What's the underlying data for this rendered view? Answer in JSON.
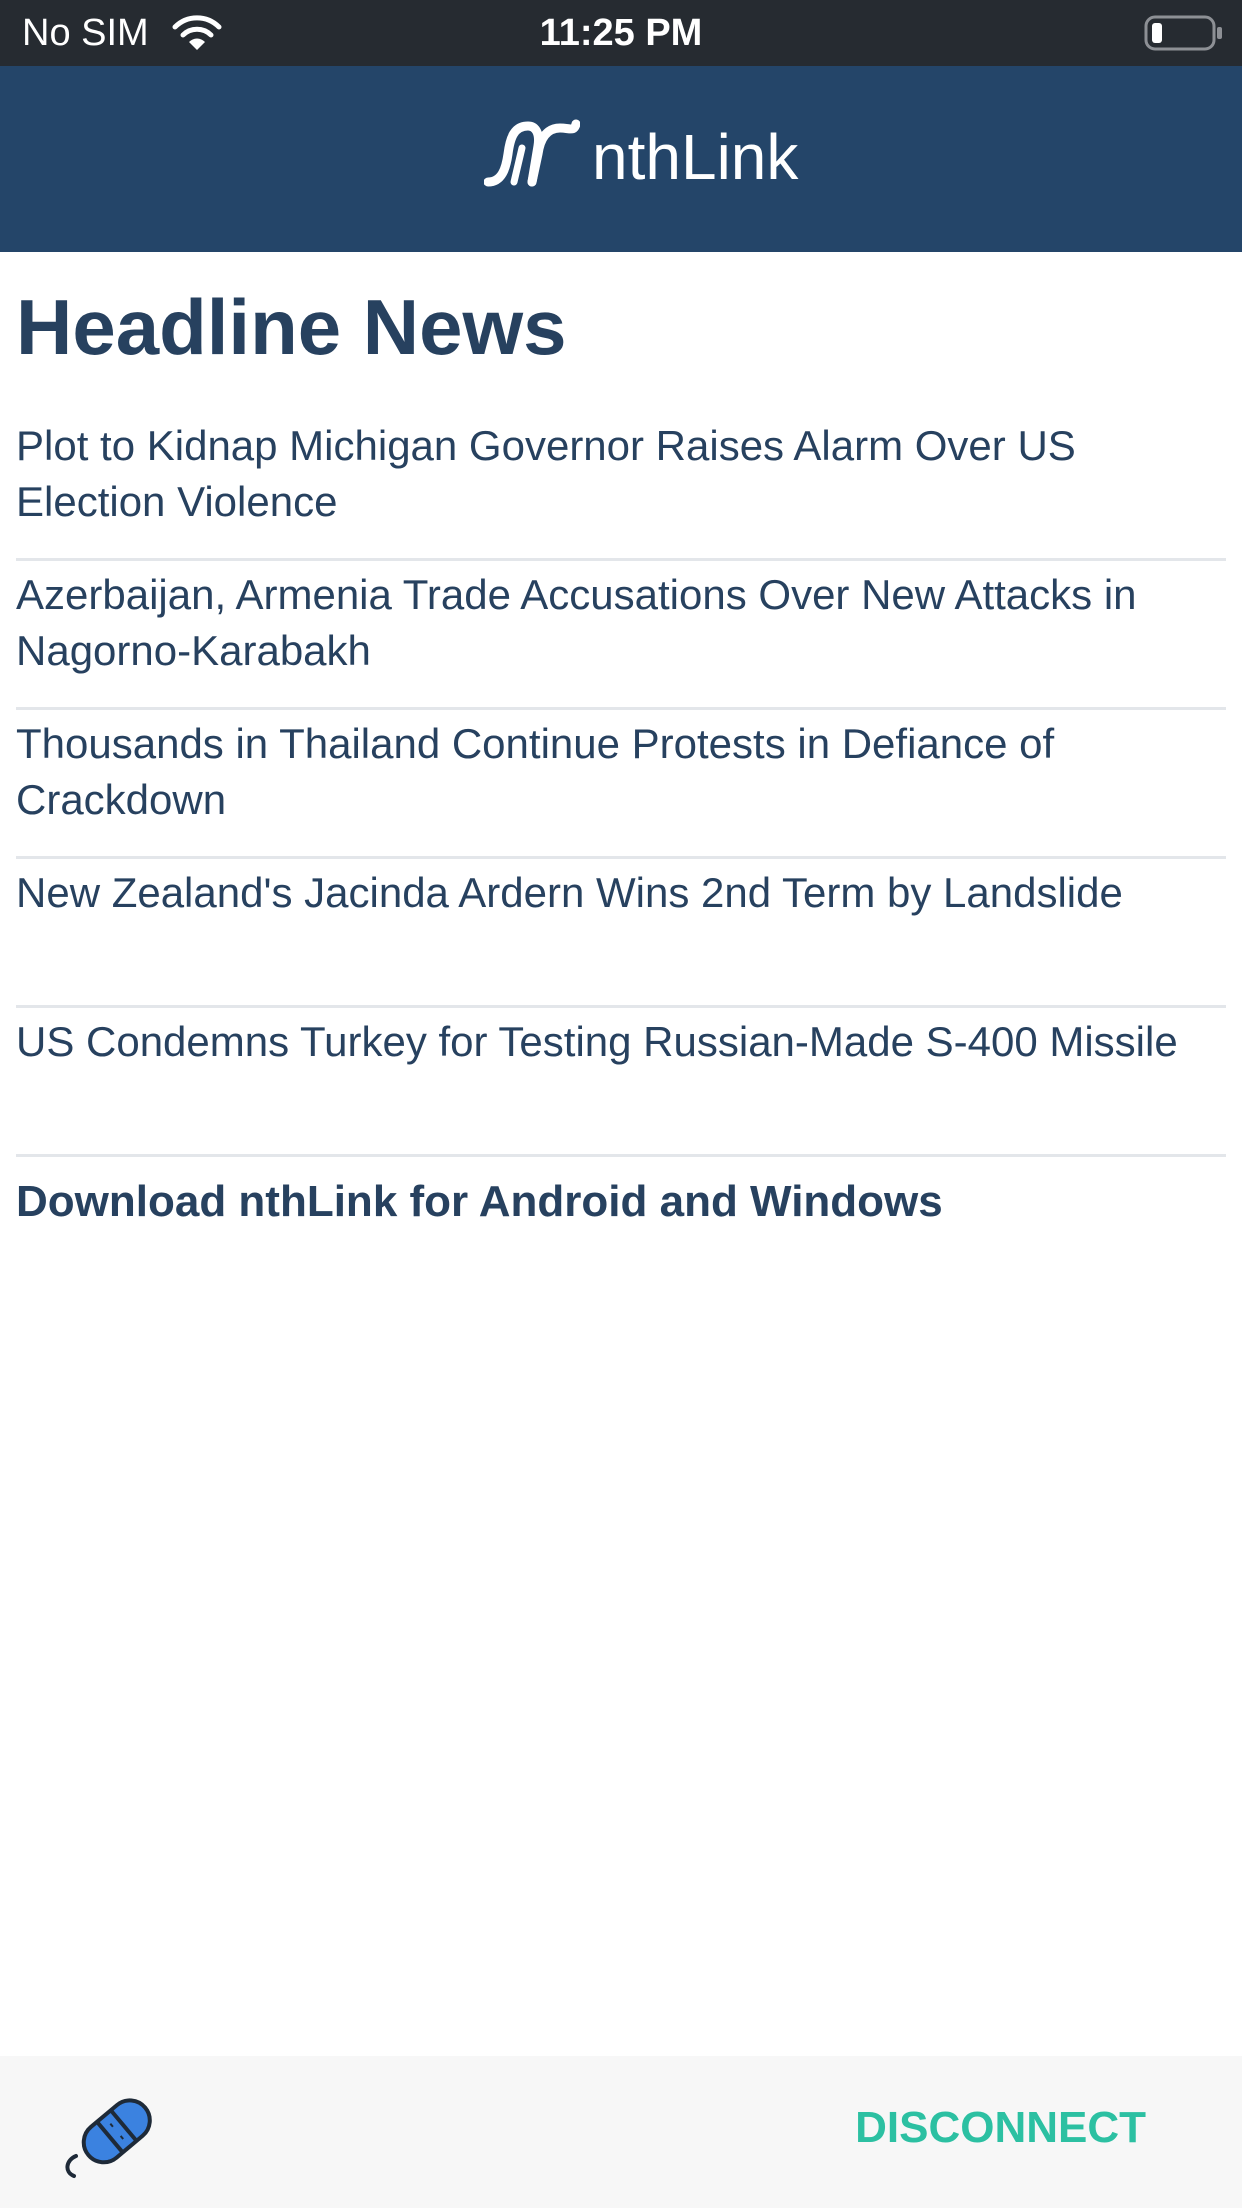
{
  "status_bar": {
    "carrier": "No SIM",
    "time": "11:25 PM",
    "icons": [
      "wifi-icon",
      "battery-icon"
    ]
  },
  "header": {
    "logo_text": "nthLink",
    "logo_icon": "nthlink-logo-icon"
  },
  "main": {
    "title": "Headline News",
    "headlines": [
      "Plot to Kidnap Michigan Governor Raises Alarm Over US Election Violence",
      "Azerbaijan, Armenia Trade Accusations Over New Attacks in Nagorno-Karabakh",
      "Thousands in Thailand Continue Protests in Defiance of Crackdown",
      "New Zealand's Jacinda Ardern Wins 2nd Term by Landslide",
      "US Condemns Turkey for Testing Russian-Made S-400 Missile"
    ],
    "download_link": "Download nthLink for Android and Windows"
  },
  "bottom_bar": {
    "connection_icon": "plug-icon",
    "disconnect_label": "DISCONNECT"
  },
  "colors": {
    "header_bg": "#244569",
    "text_primary": "#27415f",
    "accent": "#2cc0a2",
    "plug_blue": "#3b82e0"
  }
}
